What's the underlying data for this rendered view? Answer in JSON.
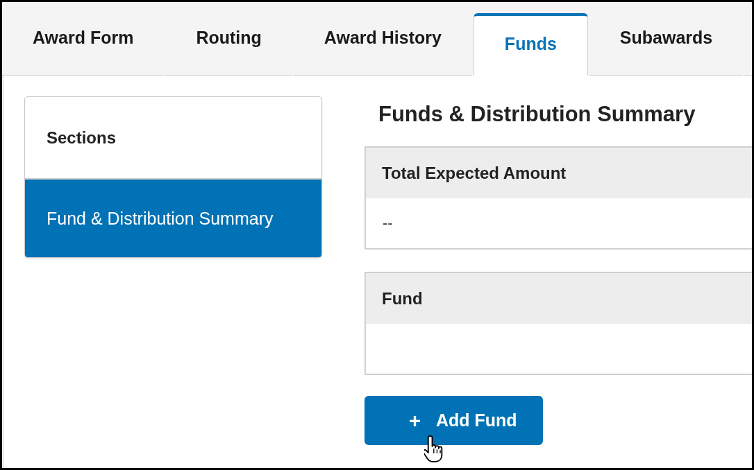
{
  "tabs": [
    {
      "label": "Award Form",
      "selected": false
    },
    {
      "label": "Routing",
      "selected": false
    },
    {
      "label": "Award History",
      "selected": false
    },
    {
      "label": "Funds",
      "selected": true
    },
    {
      "label": "Subawards",
      "selected": false
    }
  ],
  "sections_panel": {
    "title": "Sections",
    "items": [
      {
        "label": "Fund & Distribution Summary",
        "selected": true
      }
    ]
  },
  "main": {
    "title": "Funds & Distribution Summary",
    "summary_table": {
      "header": "Total Expected Amount",
      "value": "--"
    },
    "fund_table": {
      "header": "Fund"
    },
    "add_button": {
      "icon": "+",
      "label": "Add Fund"
    }
  }
}
